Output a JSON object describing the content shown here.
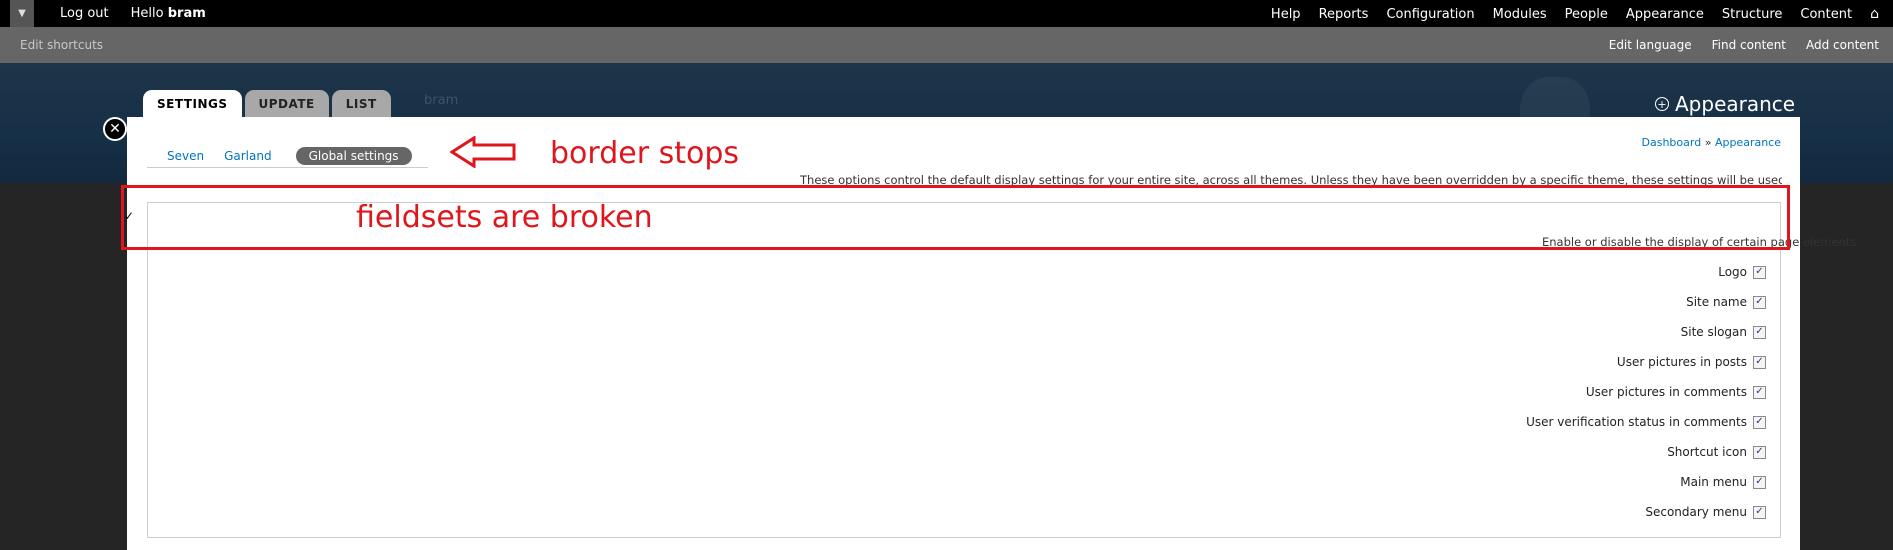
{
  "toolbar": {
    "left": [
      "Log out"
    ],
    "hello_prefix": "Hello",
    "hello_user": "bram",
    "right": [
      "Help",
      "Reports",
      "Configuration",
      "Modules",
      "People",
      "Appearance",
      "Structure",
      "Content"
    ]
  },
  "shortcuts": {
    "edit": "Edit shortcuts",
    "right": [
      "Edit language",
      "Find content",
      "Add content"
    ]
  },
  "header": {
    "faded_text": "bram",
    "overlay_title": "Appearance"
  },
  "tabs": [
    "SETTINGS",
    "UPDATE",
    "LIST"
  ],
  "subtabs": [
    "Seven",
    "Garland",
    "Global settings"
  ],
  "breadcrumb": {
    "dashboard": "Dashboard",
    "sep": "»",
    "current": "Appearance"
  },
  "description": "These options control the default display settings for your entire site, across all themes. Unless they have been overridden by a specific theme, these settings will be used",
  "fieldset": {
    "description": "Enable or disable the display of certain page elements.",
    "toggles": [
      "Logo",
      "Site name",
      "Site slogan",
      "User pictures in posts",
      "User pictures in comments",
      "User verification status in comments",
      "Shortcut icon",
      "Main menu",
      "Secondary menu"
    ]
  },
  "annotations": {
    "border_stops": "border stops",
    "fieldsets_broken": "fieldsets are broken",
    "color": "#e0161c"
  }
}
